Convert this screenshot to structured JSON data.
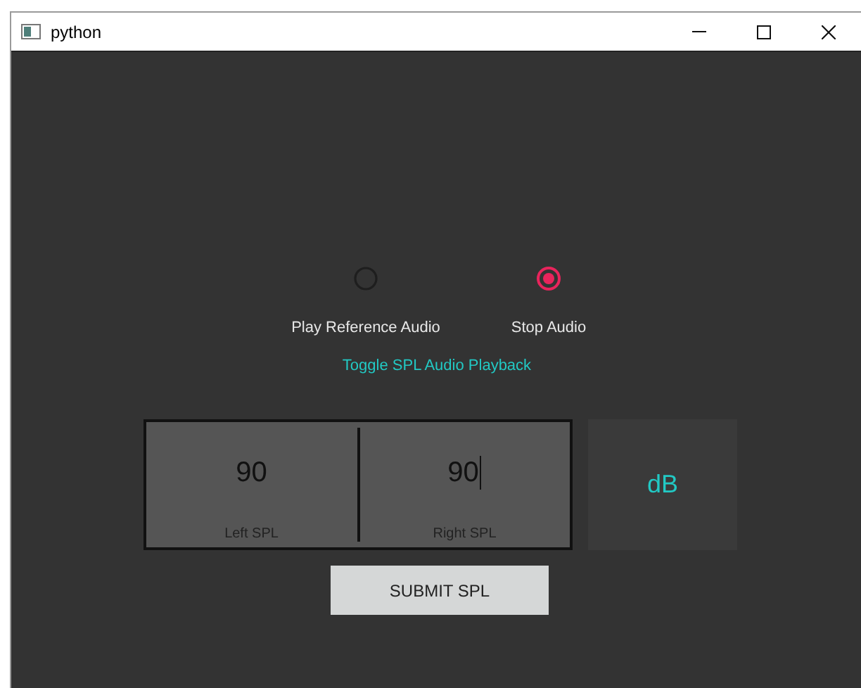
{
  "window": {
    "title": "python"
  },
  "playback": [
    {
      "label": "Play Reference Audio",
      "selected": false
    },
    {
      "label": "Stop Audio",
      "selected": true
    }
  ],
  "toggle_caption": "Toggle SPL Audio Playback",
  "spl_fields": [
    {
      "label": "Left SPL",
      "value": "90",
      "focused": false
    },
    {
      "label": "Right SPL",
      "value": "90",
      "focused": true
    }
  ],
  "unit": "dB",
  "submit_button": "SUBMIT SPL"
}
